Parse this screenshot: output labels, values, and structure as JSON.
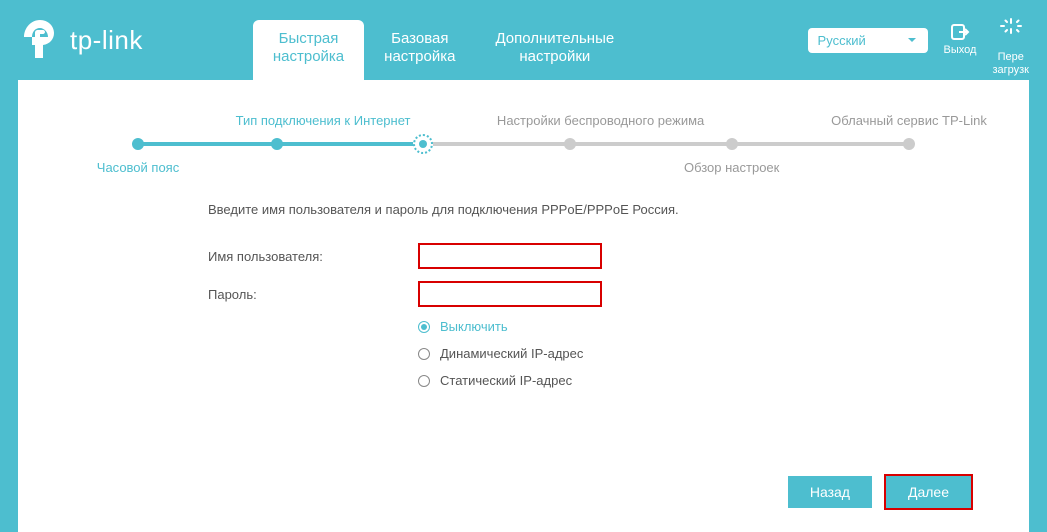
{
  "brand": "tp-link",
  "header": {
    "tabs": {
      "quick": "Быстрая\nнастройка",
      "basic": "Базовая\nнастройка",
      "advanced": "Дополнительные\nнастройки"
    },
    "language": "Русский",
    "logout": "Выход",
    "reload": "Пере\nзагрузк"
  },
  "stepper": {
    "timezone": "Часовой пояс",
    "connection": "Тип подключения к Интернет",
    "wireless": "Настройки беспроводного режима",
    "summary": "Обзор настроек",
    "cloud": "Облачный сервис TP-Link"
  },
  "form": {
    "intro": "Введите имя пользователя и пароль для подключения PPPoE/PPPoE Россия.",
    "username_label": "Имя пользователя:",
    "password_label": "Пароль:",
    "username_value": "",
    "password_value": "",
    "radios": {
      "off": "Выключить",
      "dynamic": "Динамический IP-адрес",
      "static": "Статический IP-адрес"
    }
  },
  "buttons": {
    "back": "Назад",
    "next": "Далее"
  }
}
